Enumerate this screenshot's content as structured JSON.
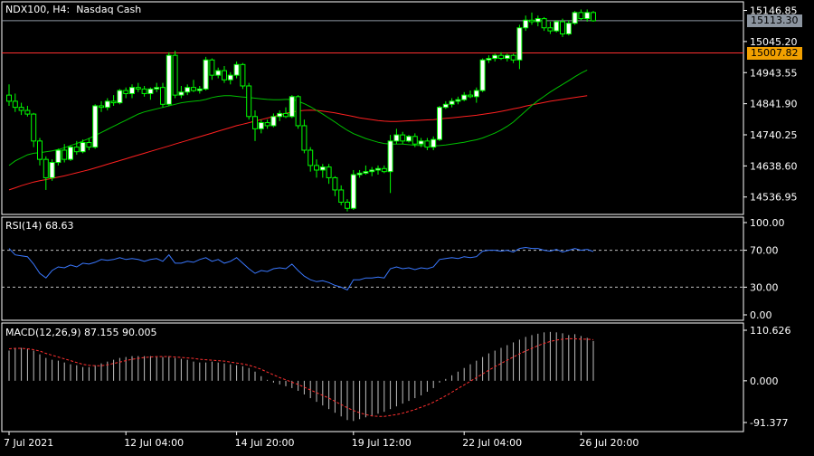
{
  "chart_data": {
    "type": "candlestick",
    "symbol": "NDX100",
    "timeframe": "H4",
    "instrument": "Nasdaq Cash",
    "title_text": "NDX100, H4:  Nasdaq Cash",
    "x_tick_labels": [
      "7 Jul 2021",
      "12 Jul 04:00",
      "14 Jul 20:00",
      "19 Jul 12:00",
      "22 Jul 04:00",
      "26 Jul 20:00"
    ],
    "price": {
      "ylim": [
        14480,
        15175
      ],
      "tick_labels": [
        "15146.85",
        "15045.20",
        "14943.55",
        "14841.90",
        "14740.25",
        "14638.60",
        "14536.95"
      ],
      "current_price": "15113.30",
      "horizontal_level": "15007.82",
      "candles": [
        [
          14870,
          14905,
          14835,
          14850
        ],
        [
          14850,
          14875,
          14815,
          14830
        ],
        [
          14830,
          14845,
          14805,
          14820
        ],
        [
          14820,
          14835,
          14800,
          14808
        ],
        [
          14808,
          14812,
          14700,
          14720
        ],
        [
          14720,
          14730,
          14640,
          14660
        ],
        [
          14660,
          14670,
          14560,
          14600
        ],
        [
          14600,
          14660,
          14590,
          14650
        ],
        [
          14650,
          14695,
          14640,
          14690
        ],
        [
          14690,
          14710,
          14650,
          14660
        ],
        [
          14660,
          14705,
          14655,
          14700
        ],
        [
          14700,
          14720,
          14675,
          14685
        ],
        [
          14685,
          14725,
          14680,
          14715
        ],
        [
          14715,
          14730,
          14690,
          14700
        ],
        [
          14700,
          14840,
          14695,
          14835
        ],
        [
          14835,
          14850,
          14815,
          14830
        ],
        [
          14830,
          14860,
          14820,
          14850
        ],
        [
          14850,
          14870,
          14835,
          14845
        ],
        [
          14845,
          14890,
          14840,
          14885
        ],
        [
          14885,
          14895,
          14860,
          14875
        ],
        [
          14875,
          14905,
          14860,
          14895
        ],
        [
          14895,
          14910,
          14880,
          14890
        ],
        [
          14890,
          14900,
          14865,
          14875
        ],
        [
          14875,
          14895,
          14855,
          14890
        ],
        [
          14890,
          14910,
          14880,
          14895
        ],
        [
          14895,
          14910,
          14830,
          14840
        ],
        [
          14840,
          15010,
          14835,
          15000
        ],
        [
          15000,
          15015,
          14860,
          14870
        ],
        [
          14870,
          14900,
          14860,
          14880
        ],
        [
          14880,
          14905,
          14870,
          14895
        ],
        [
          14895,
          14920,
          14880,
          14885
        ],
        [
          14885,
          14900,
          14875,
          14890
        ],
        [
          14890,
          14995,
          14885,
          14985
        ],
        [
          14985,
          14990,
          14920,
          14935
        ],
        [
          14935,
          14960,
          14925,
          14950
        ],
        [
          14950,
          14965,
          14910,
          14920
        ],
        [
          14920,
          14945,
          14905,
          14935
        ],
        [
          14935,
          14980,
          14925,
          14970
        ],
        [
          14970,
          14975,
          14890,
          14900
        ],
        [
          14900,
          14910,
          14790,
          14800
        ],
        [
          14800,
          14820,
          14720,
          14760
        ],
        [
          14760,
          14790,
          14745,
          14780
        ],
        [
          14780,
          14790,
          14760,
          14770
        ],
        [
          14770,
          14810,
          14765,
          14800
        ],
        [
          14800,
          14820,
          14785,
          14810
        ],
        [
          14810,
          14830,
          14795,
          14800
        ],
        [
          14800,
          14870,
          14795,
          14865
        ],
        [
          14865,
          14870,
          14760,
          14770
        ],
        [
          14770,
          14790,
          14680,
          14690
        ],
        [
          14690,
          14700,
          14620,
          14640
        ],
        [
          14640,
          14660,
          14600,
          14625
        ],
        [
          14625,
          14645,
          14600,
          14635
        ],
        [
          14635,
          14645,
          14580,
          14600
        ],
        [
          14600,
          14605,
          14540,
          14560
        ],
        [
          14560,
          14575,
          14510,
          14520
        ],
        [
          14520,
          14530,
          14490,
          14500
        ],
        [
          14500,
          14625,
          14495,
          14610
        ],
        [
          14610,
          14625,
          14600,
          14615
        ],
        [
          14615,
          14640,
          14610,
          14620
        ],
        [
          14620,
          14635,
          14605,
          14625
        ],
        [
          14625,
          14640,
          14610,
          14630
        ],
        [
          14630,
          14640,
          14615,
          14620
        ],
        [
          14620,
          14740,
          14550,
          14720
        ],
        [
          14720,
          14760,
          14710,
          14740
        ],
        [
          14740,
          14750,
          14710,
          14720
        ],
        [
          14720,
          14740,
          14715,
          14735
        ],
        [
          14735,
          14745,
          14700,
          14710
        ],
        [
          14710,
          14730,
          14700,
          14720
        ],
        [
          14720,
          14730,
          14690,
          14700
        ],
        [
          14700,
          14735,
          14690,
          14725
        ],
        [
          14725,
          14835,
          14720,
          14830
        ],
        [
          14830,
          14850,
          14825,
          14840
        ],
        [
          14840,
          14860,
          14830,
          14850
        ],
        [
          14850,
          14865,
          14840,
          14855
        ],
        [
          14855,
          14880,
          14850,
          14870
        ],
        [
          14870,
          14885,
          14860,
          14865
        ],
        [
          14865,
          14895,
          14845,
          14885
        ],
        [
          14885,
          14990,
          14880,
          14985
        ],
        [
          14985,
          15000,
          14975,
          14990
        ],
        [
          14990,
          15005,
          14980,
          15000
        ],
        [
          15000,
          15010,
          14985,
          14990
        ],
        [
          14990,
          15005,
          14980,
          15000
        ],
        [
          15000,
          15005,
          14975,
          14985
        ],
        [
          14985,
          15100,
          14955,
          15090
        ],
        [
          15090,
          15130,
          15080,
          15115
        ],
        [
          15115,
          15140,
          15100,
          15110
        ],
        [
          15110,
          15130,
          15095,
          15120
        ],
        [
          15120,
          15125,
          15080,
          15090
        ],
        [
          15090,
          15110,
          15070,
          15080
        ],
        [
          15080,
          15115,
          15075,
          15110
        ],
        [
          15110,
          15120,
          15060,
          15070
        ],
        [
          15070,
          15115,
          15065,
          15105
        ],
        [
          15105,
          15145,
          15100,
          15140
        ],
        [
          15140,
          15150,
          15115,
          15120
        ],
        [
          15120,
          15150,
          15110,
          15140
        ],
        [
          15140,
          15145,
          15110,
          15113
        ]
      ],
      "ma_fast": [
        14640,
        14655,
        14665,
        14675,
        14680,
        14682,
        14685,
        14688,
        14692,
        14698,
        14705,
        14712,
        14720,
        14728,
        14738,
        14748,
        14758,
        14768,
        14778,
        14788,
        14798,
        14808,
        14815,
        14820,
        14825,
        14830,
        14835,
        14840,
        14845,
        14848,
        14850,
        14852,
        14856,
        14862,
        14866,
        14868,
        14868,
        14866,
        14864,
        14862,
        14860,
        14858,
        14856,
        14855,
        14855,
        14856,
        14856,
        14850,
        14842,
        14832,
        14820,
        14808,
        14795,
        14782,
        14768,
        14755,
        14744,
        14736,
        14728,
        14722,
        14716,
        14712,
        14710,
        14710,
        14710,
        14708,
        14706,
        14705,
        14704,
        14704,
        14705,
        14707,
        14710,
        14713,
        14716,
        14720,
        14724,
        14730,
        14738,
        14746,
        14756,
        14768,
        14782,
        14800,
        14818,
        14836,
        14852,
        14866,
        14880,
        14893,
        14905,
        14917,
        14930,
        14942,
        14952
      ],
      "ma_slow": [
        14560,
        14567,
        14574,
        14580,
        14586,
        14590,
        14594,
        14598,
        14602,
        14606,
        14611,
        14616,
        14621,
        14626,
        14632,
        14638,
        14644,
        14650,
        14656,
        14662,
        14668,
        14674,
        14680,
        14686,
        14692,
        14698,
        14704,
        14710,
        14716,
        14722,
        14728,
        14734,
        14740,
        14746,
        14752,
        14758,
        14764,
        14770,
        14775,
        14780,
        14785,
        14790,
        14795,
        14800,
        14805,
        14810,
        14815,
        14818,
        14820,
        14821,
        14820,
        14818,
        14815,
        14812,
        14808,
        14804,
        14800,
        14796,
        14793,
        14790,
        14787,
        14785,
        14784,
        14784,
        14785,
        14786,
        14787,
        14788,
        14789,
        14790,
        14792,
        14794,
        14796,
        14798,
        14800,
        14802,
        14804,
        14807,
        14810,
        14813,
        14817,
        14821,
        14825,
        14829,
        14834,
        14838,
        14842,
        14846,
        14850,
        14853,
        14856,
        14859,
        14862,
        14865,
        14868
      ]
    },
    "rsi": {
      "label": "RSI(14) 68.63",
      "ylim": [
        0,
        100
      ],
      "tick_labels": [
        "100.00",
        "70.00",
        "30.00",
        "0.00"
      ],
      "levels": [
        70,
        30
      ],
      "values": [
        72,
        65,
        64,
        63,
        55,
        45,
        40,
        48,
        52,
        51,
        54,
        52,
        56,
        55,
        57,
        60,
        59,
        60,
        62,
        60,
        61,
        60,
        58,
        60,
        61,
        58,
        65,
        56,
        56,
        58,
        57,
        60,
        62,
        58,
        60,
        56,
        58,
        62,
        56,
        50,
        45,
        48,
        47,
        50,
        51,
        50,
        55,
        48,
        42,
        38,
        36,
        37,
        35,
        32,
        30,
        27,
        38,
        38,
        40,
        40,
        41,
        40,
        50,
        52,
        50,
        51,
        49,
        51,
        50,
        52,
        60,
        61,
        62,
        61,
        63,
        62,
        63,
        69,
        70,
        70,
        69,
        70,
        68,
        72,
        73,
        72,
        72,
        70,
        69,
        71,
        68,
        70,
        72,
        70,
        71,
        68.63
      ]
    },
    "macd": {
      "label": "MACD(12,26,9) 87.155 90.005",
      "ylim": [
        -91.377,
        110.626
      ],
      "tick_labels": [
        "110.626",
        "0.000",
        "-91.377"
      ],
      "histogram": [
        66,
        70,
        72,
        70,
        66,
        58,
        50,
        46,
        44,
        40,
        36,
        34,
        30,
        30,
        34,
        38,
        42,
        46,
        50,
        52,
        54,
        54,
        54,
        54,
        52,
        52,
        54,
        50,
        48,
        46,
        42,
        40,
        40,
        42,
        40,
        38,
        36,
        34,
        32,
        28,
        20,
        10,
        2,
        -4,
        -8,
        -12,
        -16,
        -22,
        -30,
        -38,
        -46,
        -54,
        -62,
        -70,
        -78,
        -86,
        -88,
        -84,
        -80,
        -76,
        -72,
        -68,
        -62,
        -56,
        -50,
        -44,
        -38,
        -32,
        -24,
        -16,
        -4,
        4,
        12,
        20,
        28,
        36,
        44,
        52,
        60,
        66,
        72,
        78,
        84,
        90,
        96,
        100,
        103,
        106,
        107,
        106,
        104,
        100,
        102,
        98,
        94,
        87.155
      ],
      "signal": [
        70,
        71,
        71,
        70,
        68,
        65,
        60,
        56,
        52,
        48,
        44,
        40,
        36,
        34,
        33,
        33,
        35,
        38,
        41,
        44,
        47,
        49,
        51,
        52,
        53,
        53,
        53,
        52,
        51,
        50,
        49,
        47,
        46,
        45,
        44,
        43,
        41,
        39,
        37,
        34,
        30,
        25,
        19,
        13,
        7,
        2,
        -3,
        -8,
        -14,
        -20,
        -26,
        -32,
        -38,
        -45,
        -52,
        -59,
        -65,
        -70,
        -74,
        -77,
        -78,
        -78,
        -76,
        -74,
        -71,
        -67,
        -63,
        -58,
        -53,
        -47,
        -40,
        -33,
        -25,
        -17,
        -9,
        -1,
        7,
        15,
        23,
        31,
        38,
        45,
        52,
        59,
        65,
        71,
        77,
        82,
        86,
        89,
        91,
        92,
        92,
        91,
        91,
        90.005
      ]
    }
  },
  "colors": {
    "background": "#000000",
    "frame": "#ffffff",
    "grid_text": "#ffffff",
    "bull": "#00ff00",
    "bear": "#00ff00",
    "ma_fast": "#00c000",
    "ma_slow": "#ff2020",
    "rsi_line": "#3a78ff",
    "rsi_levels": "#c0c0c0",
    "macd_hist": "#c0c0c0",
    "macd_signal": "#ff3030",
    "current_line": "#8c95a0",
    "level_line": "#ff3030"
  }
}
